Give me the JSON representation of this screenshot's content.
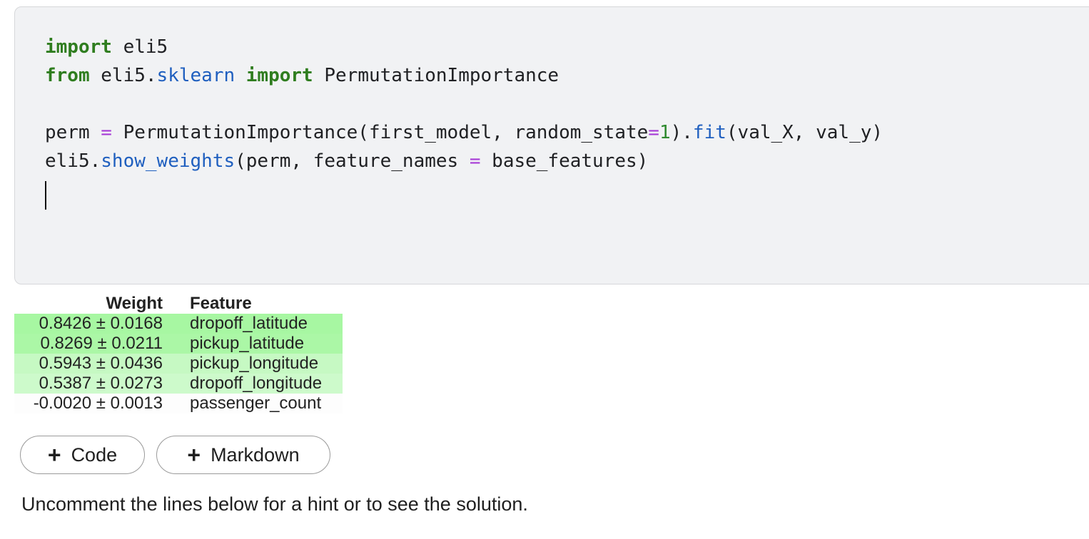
{
  "code_cell": {
    "lines": [
      [
        {
          "text": "import",
          "class": "kw"
        },
        {
          "text": " eli5",
          "class": ""
        }
      ],
      [
        {
          "text": "from",
          "class": "kw"
        },
        {
          "text": " eli5.",
          "class": ""
        },
        {
          "text": "sklearn",
          "class": "attr"
        },
        {
          "text": " ",
          "class": ""
        },
        {
          "text": "import",
          "class": "kw"
        },
        {
          "text": " PermutationImportance",
          "class": ""
        }
      ],
      [],
      [
        {
          "text": "perm ",
          "class": ""
        },
        {
          "text": "=",
          "class": "op"
        },
        {
          "text": " PermutationImportance(first_model, random_state",
          "class": ""
        },
        {
          "text": "=",
          "class": "op"
        },
        {
          "text": "1",
          "class": "num"
        },
        {
          "text": ").",
          "class": ""
        },
        {
          "text": "fit",
          "class": "attr"
        },
        {
          "text": "(val_X, val_y)",
          "class": ""
        }
      ],
      [
        {
          "text": "eli5.",
          "class": ""
        },
        {
          "text": "show_weights",
          "class": "attr"
        },
        {
          "text": "(perm, feature_names ",
          "class": ""
        },
        {
          "text": "=",
          "class": "op"
        },
        {
          "text": " base_features)",
          "class": ""
        }
      ]
    ]
  },
  "output": {
    "headers": {
      "weight": "Weight",
      "feature": "Feature"
    },
    "rows": [
      {
        "weight": "0.8426 ± 0.0168",
        "feature": "dropoff_latitude",
        "bg": "#a7f7a2"
      },
      {
        "weight": "0.8269 ± 0.0211",
        "feature": "pickup_latitude",
        "bg": "#abf7a6"
      },
      {
        "weight": "0.5943 ± 0.0436",
        "feature": "pickup_longitude",
        "bg": "#c6f9c3"
      },
      {
        "weight": "0.5387 ± 0.0273",
        "feature": "dropoff_longitude",
        "bg": "#cdfacb"
      },
      {
        "weight": "-0.0020 ± 0.0013",
        "feature": "passenger_count",
        "bg": "#fdfdfd"
      }
    ]
  },
  "buttons": {
    "add_code": {
      "plus": "+",
      "label": "Code"
    },
    "add_markdown": {
      "plus": "+",
      "label": "Markdown"
    }
  },
  "markdown": {
    "hint_text": "Uncomment the lines below for a hint or to see the solution."
  }
}
